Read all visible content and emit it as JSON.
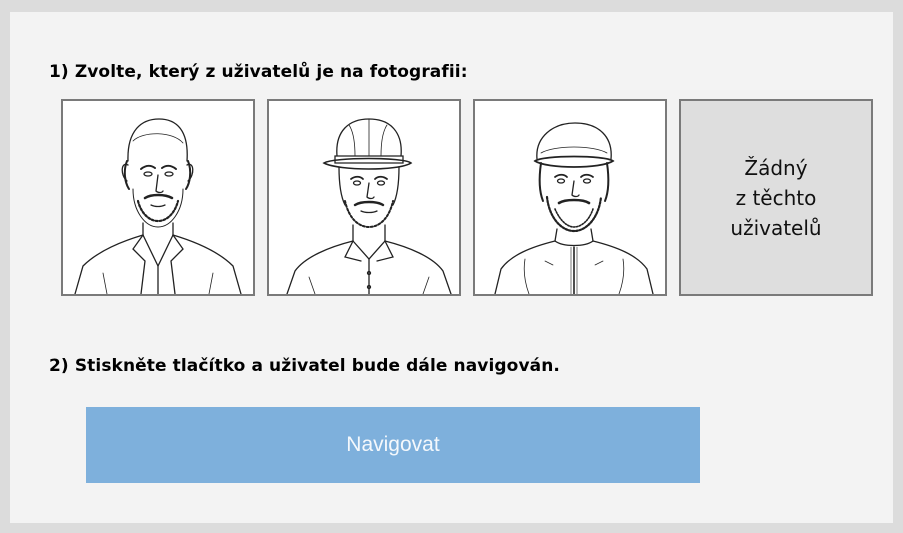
{
  "step1": {
    "label": "1) Zvolte, který z uživatelů je na fotografii:"
  },
  "users": [
    {
      "id": "user-1",
      "icon": "sketch-portrait-bald-man-suit"
    },
    {
      "id": "user-2",
      "icon": "sketch-portrait-man-cap"
    },
    {
      "id": "user-3",
      "icon": "sketch-portrait-man-flat-cap-jacket"
    }
  ],
  "none_option": {
    "line1": "Žádný",
    "line2": "z těchto",
    "line3": "uživatelů"
  },
  "step2": {
    "label": "2) Stiskněte tlačítko a uživatel bude dále navigován."
  },
  "navigate_button": {
    "label": "Navigovat"
  },
  "colors": {
    "background": "#dcdcdc",
    "panel": "#f3f3f3",
    "tile_border": "#7a7a7a",
    "none_tile": "#dedede",
    "button": "#7eb0dc",
    "button_text": "#f4f8fc"
  }
}
